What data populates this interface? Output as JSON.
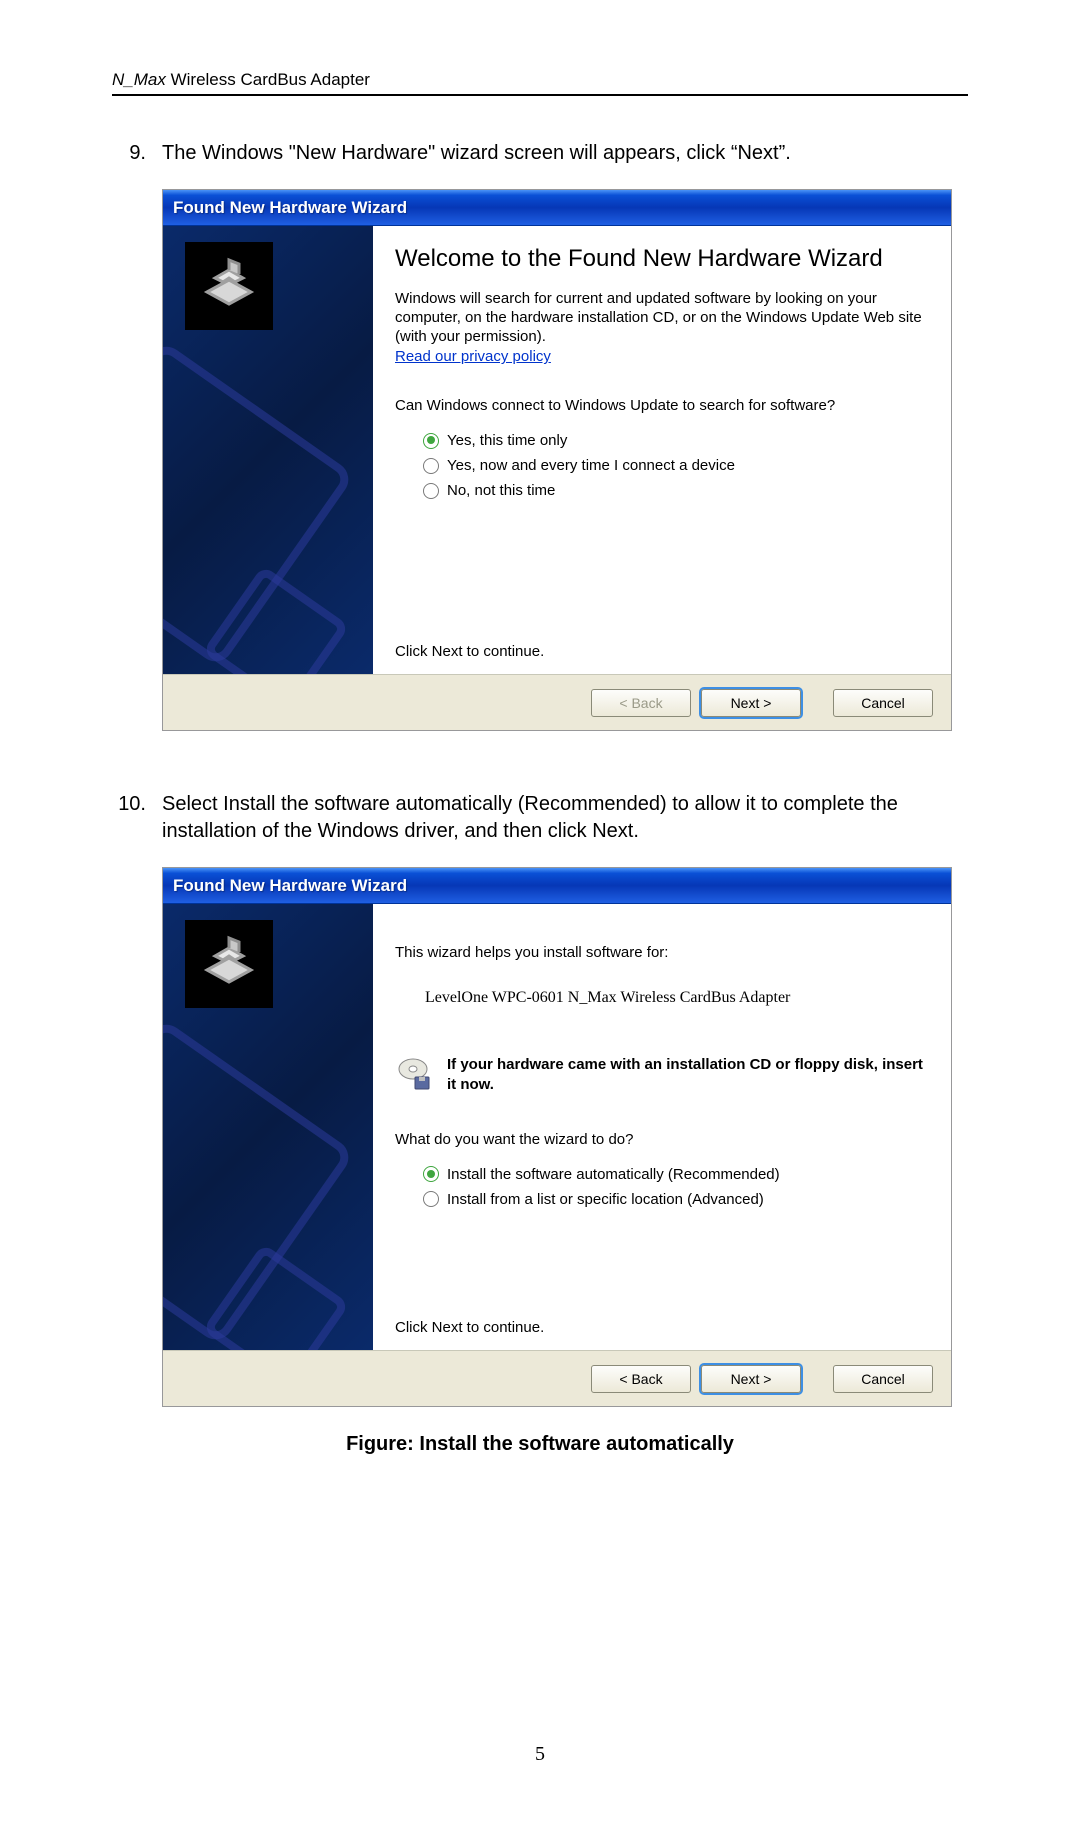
{
  "header": {
    "brand": "N_Max",
    "product": " Wireless CardBus Adapter"
  },
  "step9": {
    "num": "9.",
    "text": "The Windows \"New Hardware\" wizard screen will appears, click “Next”."
  },
  "wizard1": {
    "title": "Found New Hardware Wizard",
    "heading": "Welcome to the Found New Hardware Wizard",
    "intro": "Windows will search for current and updated software by looking on your computer, on the hardware installation CD, or on the Windows Update Web site (with your permission).",
    "privacy": "Read our privacy policy",
    "question": "Can Windows connect to Windows Update to search for software?",
    "options": [
      "Yes, this time only",
      "Yes, now and every time I connect a device",
      "No, not this time"
    ],
    "continue": "Click Next to continue.",
    "back": "< Back",
    "next": "Next >",
    "cancel": "Cancel"
  },
  "step10": {
    "num": "10.",
    "text": "Select Install the software automatically (Recommended) to allow it to complete the installation of the Windows driver, and then click Next."
  },
  "wizard2": {
    "title": "Found New Hardware Wizard",
    "helps": "This wizard helps you install software for:",
    "device": "LevelOne WPC-0601 N_Max Wireless CardBus Adapter",
    "cd_note": "If your hardware came with an installation CD or floppy disk, insert it now.",
    "question": "What do you want the wizard to do?",
    "options": [
      "Install the software automatically (Recommended)",
      "Install from a list or specific location (Advanced)"
    ],
    "continue": "Click Next to continue.",
    "back": "< Back",
    "next": "Next >",
    "cancel": "Cancel"
  },
  "figure_caption": "Figure: Install the software automatically",
  "page_number": "5"
}
